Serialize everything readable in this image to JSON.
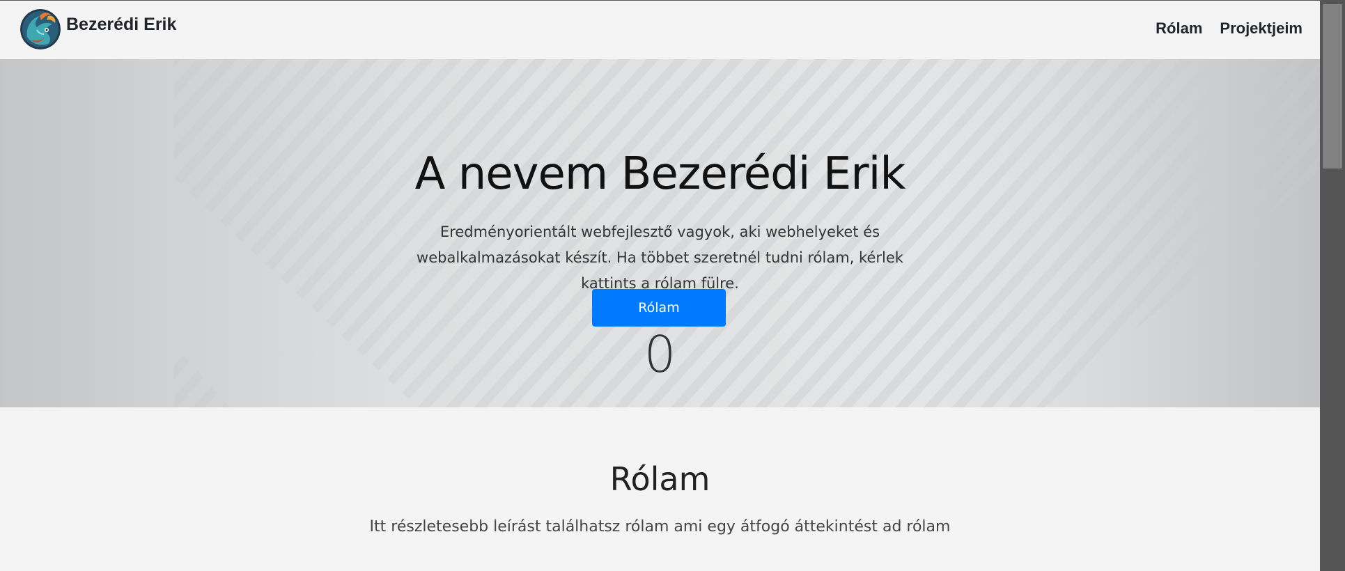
{
  "brand": {
    "name": "Bezerédi Erik",
    "logo_icon": "dragon-logo-icon"
  },
  "nav": {
    "items": [
      {
        "label": "Rólam"
      },
      {
        "label": "Projektjeim"
      }
    ]
  },
  "hero": {
    "title": "A nevem Bezerédi Erik",
    "text": "Eredményorientált webfejlesztő vagyok, aki webhelyeket és webalkalmazásokat készít. Ha többet szeretnél tudni rólam, kérlek kattints a rólam fülre.",
    "button_label": "Rólam",
    "counter": "0"
  },
  "about": {
    "title": "Rólam",
    "text": "Itt részletesebb leírást találhatsz rólam ami egy átfogó áttekintést ad rólam"
  },
  "colors": {
    "accent": "#007bff",
    "background": "#f4f4f4",
    "text": "#212529"
  }
}
